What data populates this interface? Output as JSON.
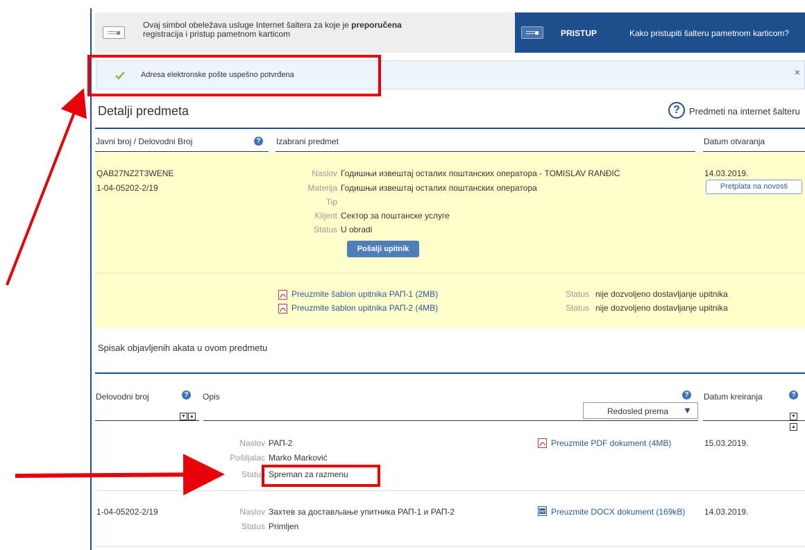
{
  "banner": {
    "text_part1": "Ovaj simbol obeležava usluge Internet šaltera za koje je ",
    "text_bold": "preporučena",
    "text_part2": "registracija i pristup pametnom karticom",
    "access_label": "PRISTUP",
    "access_link": "Kako pristupiti šalteru pametnom karticom?"
  },
  "alert": {
    "message": "Adresa elektronske pošte uspešno potvrđena",
    "close": "×"
  },
  "details": {
    "title": "Detalji predmeta",
    "help_symbol": "?",
    "side_link": "Predmeti na internet šalteru"
  },
  "table_headers": {
    "col1": "Javni broj / Delovodni Broj",
    "col2": "Izabrani predmet",
    "col3": "Datum otvaranja"
  },
  "case": {
    "public_number": "QAB27NZ2T3WENE",
    "delivery_number": "1-04-05202-2/19",
    "fields": [
      {
        "label": "Naslov",
        "value": "Годишњи извештај осталих поштанских оператора - TOMISLAV RANĐIĆ"
      },
      {
        "label": "Materija",
        "value": "Годишњи извештај осталих поштанских оператора"
      },
      {
        "label": "Tip",
        "value": ""
      },
      {
        "label": "Klijent",
        "value": "Сектор за поштанске услуге"
      },
      {
        "label": "Status",
        "value": "U obradi"
      }
    ],
    "send_button": "Pošalji upitnik",
    "date": "14.03.2019.",
    "subscribe_button": "Pretplata na novosti"
  },
  "templates": [
    {
      "link": "Preuzmite šablon upitnika РАП-1 (2MB)",
      "status_label": "Status",
      "status_value": "nije dozvoljeno dostavljanje upitnika"
    },
    {
      "link": "Preuzmite šablon upitnika РАП-2 (4MB)",
      "status_label": "Status",
      "status_value": "nije dozvoljeno dostavljanje upitnika"
    }
  ],
  "acts": {
    "title": "Spisak objavljenih akata u ovom predmetu",
    "headers": {
      "col1": "Delovodni broj",
      "col2": "Opis",
      "col3": "Datum kreiranja"
    },
    "sort_label": "Redosled prema",
    "sort_down": "▼",
    "sort_up": "▲",
    "rows": [
      {
        "number": "",
        "fields": [
          {
            "label": "Naslov",
            "value": "РАП-2"
          },
          {
            "label": "Pošiljalac",
            "value": "Marko Marković"
          },
          {
            "label": "Status",
            "value": "Spreman za razmenu"
          }
        ],
        "doc_link": "Preuzmite PDF dokument (4MB)",
        "date": "15.03.2019."
      },
      {
        "number": "1-04-05202-2/19",
        "fields": [
          {
            "label": "Naslov",
            "value": "Захтев за достављање упитника РАП-1 и РАП-2"
          },
          {
            "label": "Status",
            "value": "Primljen"
          }
        ],
        "doc_link": "Preuzmite DOCX dokument (169kB)",
        "date": "14.03.2019."
      }
    ]
  },
  "colors": {
    "brand": "#1f4e8c",
    "annotation": "#e8000b",
    "highlight": "#ffffcc"
  }
}
